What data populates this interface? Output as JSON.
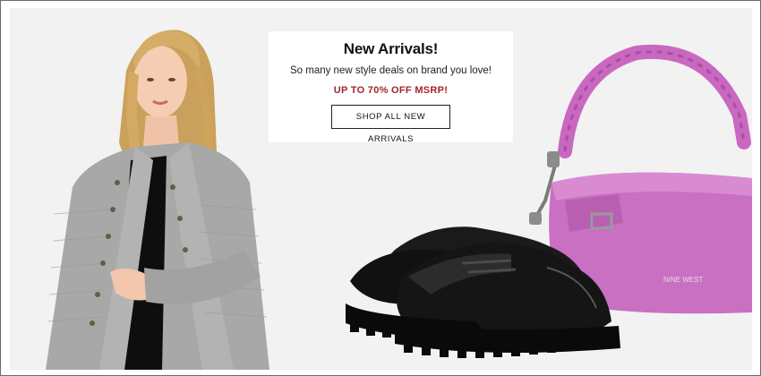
{
  "promo": {
    "title": "New Arrivals!",
    "subtitle": "So many new style deals on brand you love!",
    "offer": "UP TO 70% OFF MSRP!",
    "cta_label": "SHOP ALL NEW ARRIVALS"
  },
  "handbag": {
    "brand_logo_text": "NINE WEST"
  },
  "colors": {
    "offer_red": "#a3262a",
    "handbag_pink": "#c96fc2",
    "jacket_gray": "#a6a6a6",
    "shoe_black": "#151515"
  }
}
